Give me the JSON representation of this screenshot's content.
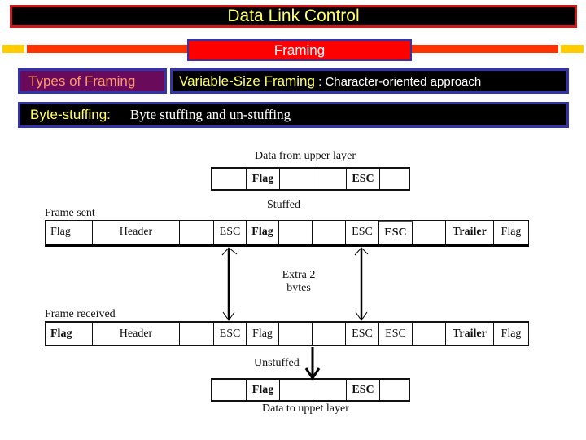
{
  "slide": {
    "title": "Data Link Control",
    "section": "Framing",
    "types_label": "Types of  Framing",
    "variable_title": "Variable-Size Framing",
    "variable_sep": " : ",
    "variable_subtitle": "Character-oriented approach",
    "byte_label": "Byte-stuffing:",
    "byte_desc": "Byte stuffing and un-stuffing"
  },
  "colors": {
    "title_bg": "#000000",
    "title_border": "#cc1a1a",
    "title_text": "#ffff66",
    "section_bg": "#ff0000",
    "section_border": "#3333aa",
    "deco_orange": "#ff3300",
    "deco_yellow": "#ffcc00",
    "types_bg": "#6a0a5a",
    "types_text": "#ff9966"
  },
  "diagram": {
    "data_from_upper_caption": "Data from upper layer",
    "data_from_upper_cells": [
      "",
      "Flag",
      "",
      "",
      "ESC",
      ""
    ],
    "stuffed_caption": "Stuffed",
    "frame_sent_caption": "Frame sent",
    "frame_sent_cells": [
      "Flag",
      "Header",
      "",
      "ESC",
      "Flag",
      "",
      "",
      "ESC",
      "ESC",
      "",
      "Trailer",
      "Flag"
    ],
    "extra_caption_line1": "Extra 2",
    "extra_caption_line2": "bytes",
    "frame_received_caption": "Frame received",
    "frame_received_cells": [
      "Flag",
      "Header",
      "",
      "ESC",
      "Flag",
      "",
      "",
      "ESC",
      "ESC",
      "",
      "Trailer",
      "Flag"
    ],
    "unstuffed_caption": "Unstuffed",
    "data_to_upper_cells": [
      "",
      "Flag",
      "",
      "",
      "ESC",
      ""
    ],
    "data_to_upper_caption": "Data to uppet layer"
  }
}
